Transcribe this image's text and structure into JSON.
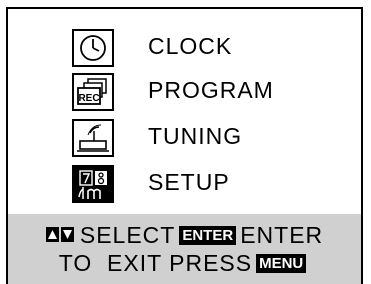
{
  "menu": {
    "items": [
      {
        "label": "CLOCK",
        "icon": "clock-icon"
      },
      {
        "label": "PROGRAM",
        "icon": "rec-program-icon",
        "icon_text": "REC"
      },
      {
        "label": "TUNING",
        "icon": "antenna-tuner-icon"
      },
      {
        "label": "SETUP",
        "icon": "setup-icon",
        "selected": true
      }
    ]
  },
  "footer": {
    "select_label": "SELECT",
    "enter_key": "ENTER",
    "enter_label": "ENTER",
    "exit_text": "TO  EXIT PRESS",
    "menu_key": "MENU"
  },
  "colors": {
    "footer_bg": "#d0d0d0",
    "tag_bg": "#000000",
    "tag_fg": "#ffffff"
  }
}
